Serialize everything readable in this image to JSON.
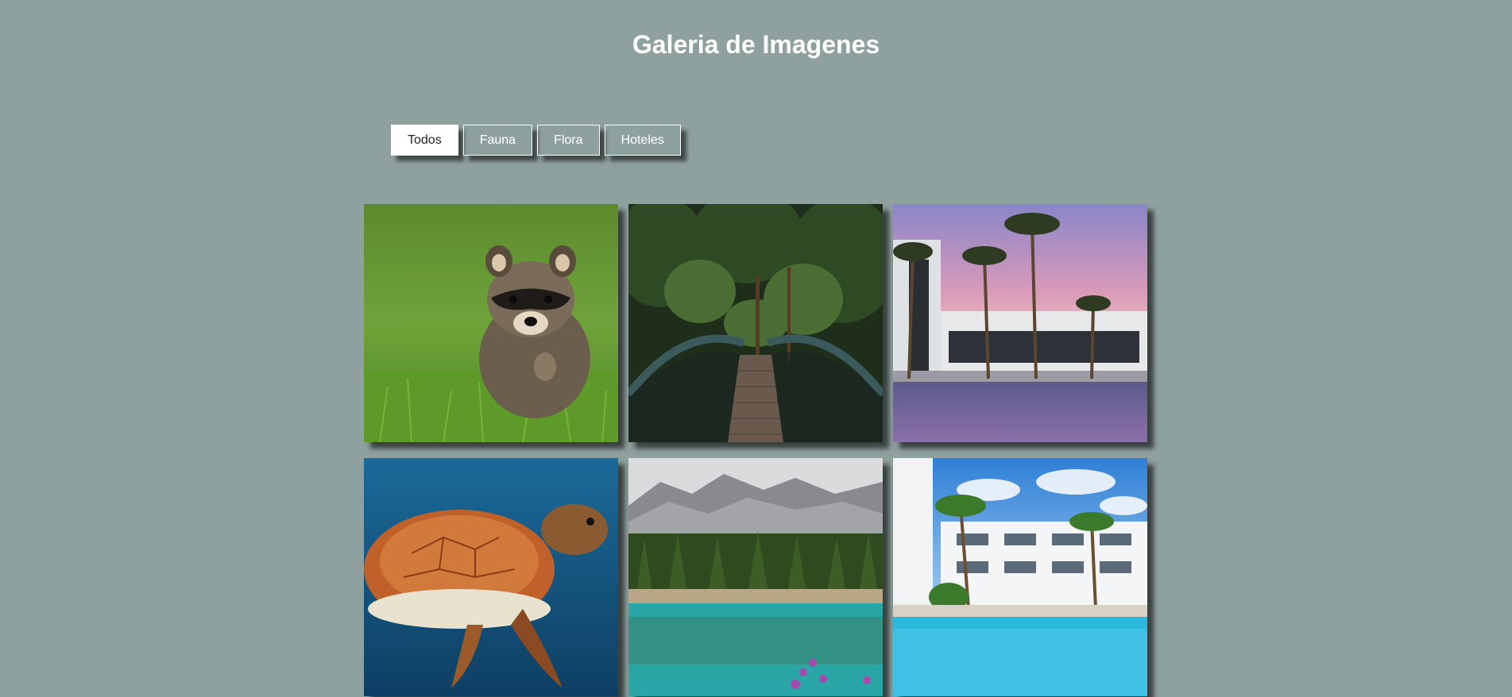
{
  "header": {
    "title": "Galeria de Imagenes"
  },
  "filters": [
    {
      "label": "Todos",
      "active": true
    },
    {
      "label": "Fauna",
      "active": false
    },
    {
      "label": "Flora",
      "active": false
    },
    {
      "label": "Hoteles",
      "active": false
    }
  ],
  "gallery": {
    "images": [
      {
        "subject": "raccoon-in-grass",
        "category": "Fauna"
      },
      {
        "subject": "forest-bridge",
        "category": "Flora"
      },
      {
        "subject": "hotel-pool-sunset-palms",
        "category": "Hoteles"
      },
      {
        "subject": "sea-turtle",
        "category": "Fauna"
      },
      {
        "subject": "mountain-lake-forest",
        "category": "Flora"
      },
      {
        "subject": "hotel-pool-daytime",
        "category": "Hoteles"
      }
    ]
  },
  "colors": {
    "background": "#8fa19f",
    "title": "#ffffff",
    "button_border": "#ffffff",
    "button_active_bg": "#ffffff"
  }
}
